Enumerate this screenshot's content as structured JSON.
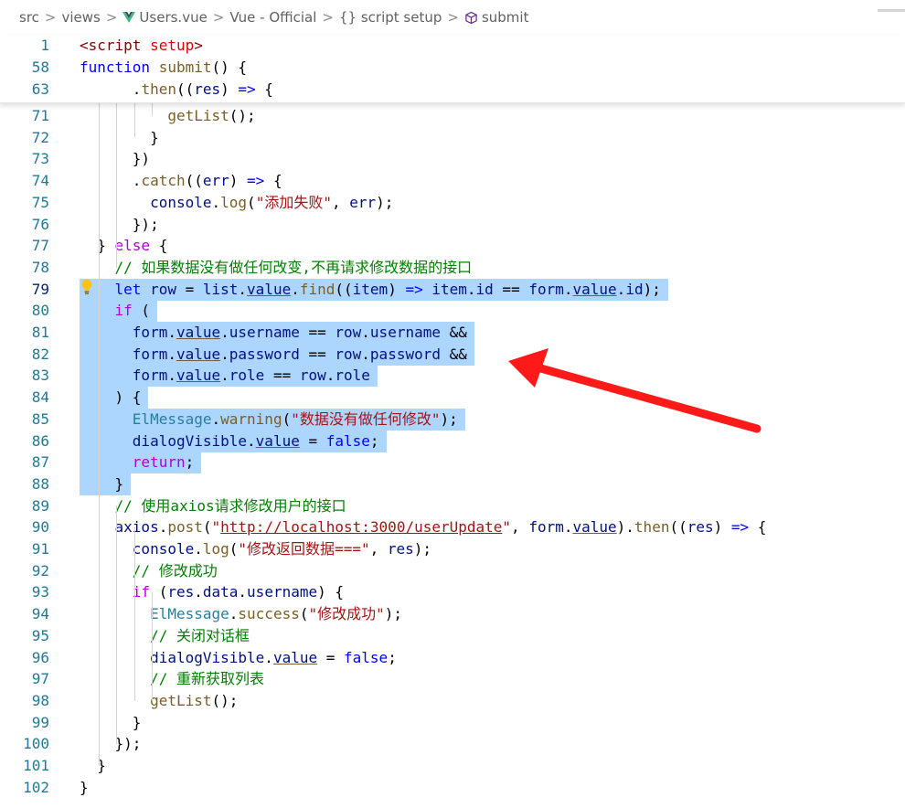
{
  "breadcrumb": {
    "items": [
      "src",
      "views",
      "Users.vue",
      "Vue - Official",
      "{} script setup",
      "submit"
    ],
    "separator": ">"
  },
  "sticky_lines": [
    {
      "num": "1",
      "tokens": [
        [
          "tag",
          "<script "
        ],
        [
          "attr",
          "setup"
        ],
        [
          "tag",
          ">"
        ]
      ]
    },
    {
      "num": "58",
      "tokens": [
        [
          "kw",
          "function "
        ],
        [
          "fn",
          "submit"
        ],
        [
          "",
          "() {"
        ]
      ]
    },
    {
      "num": "63",
      "tokens": [
        [
          "",
          "      ."
        ],
        [
          "fn",
          "then"
        ],
        [
          "",
          "(("
        ],
        [
          "var",
          "res"
        ],
        [
          "",
          ") "
        ],
        [
          "kw",
          "=>"
        ],
        [
          "",
          " {"
        ]
      ]
    }
  ],
  "lines": [
    {
      "num": "71",
      "tokens": [
        [
          "",
          "          "
        ],
        [
          "fn",
          "getList"
        ],
        [
          "",
          "();"
        ]
      ]
    },
    {
      "num": "72",
      "tokens": [
        [
          "",
          "        }"
        ]
      ]
    },
    {
      "num": "73",
      "tokens": [
        [
          "",
          "      })"
        ]
      ]
    },
    {
      "num": "74",
      "tokens": [
        [
          "",
          "      ."
        ],
        [
          "fn",
          "catch"
        ],
        [
          "",
          "(("
        ],
        [
          "var",
          "err"
        ],
        [
          "",
          ") "
        ],
        [
          "kw",
          "=>"
        ],
        [
          "",
          " {"
        ]
      ]
    },
    {
      "num": "75",
      "tokens": [
        [
          "",
          "        "
        ],
        [
          "var",
          "console"
        ],
        [
          "",
          "."
        ],
        [
          "fn",
          "log"
        ],
        [
          "",
          "("
        ],
        [
          "str",
          "\"添加失败\""
        ],
        [
          "",
          ", "
        ],
        [
          "var",
          "err"
        ],
        [
          "",
          ");"
        ]
      ]
    },
    {
      "num": "76",
      "tokens": [
        [
          "",
          "      });"
        ]
      ]
    },
    {
      "num": "77",
      "tokens": [
        [
          "",
          "  } "
        ],
        [
          "ctl",
          "else"
        ],
        [
          "",
          " {"
        ]
      ]
    },
    {
      "num": "78",
      "tokens": [
        [
          "",
          "    "
        ],
        [
          "cm",
          "// 如果数据没有做任何改变,不再请求修改数据的接口"
        ]
      ]
    },
    {
      "num": "79",
      "active": true,
      "tokens": [
        [
          "",
          "    "
        ],
        [
          "kw",
          "let "
        ],
        [
          "var",
          "row"
        ],
        [
          "",
          " = "
        ],
        [
          "var",
          "list"
        ],
        [
          "",
          "."
        ],
        [
          "var u",
          "value"
        ],
        [
          "",
          "."
        ],
        [
          "fn",
          "find"
        ],
        [
          "",
          "(("
        ],
        [
          "var",
          "item"
        ],
        [
          "",
          ") "
        ],
        [
          "kw",
          "=>"
        ],
        [
          "",
          " "
        ],
        [
          "var",
          "item"
        ],
        [
          "",
          "."
        ],
        [
          "var",
          "id"
        ],
        [
          "",
          " == "
        ],
        [
          "var",
          "form"
        ],
        [
          "",
          "."
        ],
        [
          "var u",
          "value"
        ],
        [
          "",
          "."
        ],
        [
          "var",
          "id"
        ],
        [
          "",
          ");"
        ]
      ]
    },
    {
      "num": "80",
      "tokens": [
        [
          "",
          "    "
        ],
        [
          "ctl",
          "if"
        ],
        [
          "",
          " ("
        ]
      ]
    },
    {
      "num": "81",
      "tokens": [
        [
          "",
          "      "
        ],
        [
          "var",
          "form"
        ],
        [
          "",
          "."
        ],
        [
          "var u",
          "value"
        ],
        [
          "",
          "."
        ],
        [
          "var",
          "username"
        ],
        [
          "",
          " == "
        ],
        [
          "var",
          "row"
        ],
        [
          "",
          "."
        ],
        [
          "var",
          "username"
        ],
        [
          "",
          " &&"
        ]
      ]
    },
    {
      "num": "82",
      "tokens": [
        [
          "",
          "      "
        ],
        [
          "var",
          "form"
        ],
        [
          "",
          "."
        ],
        [
          "var u",
          "value"
        ],
        [
          "",
          "."
        ],
        [
          "var",
          "password"
        ],
        [
          "",
          " == "
        ],
        [
          "var",
          "row"
        ],
        [
          "",
          "."
        ],
        [
          "var",
          "password"
        ],
        [
          "",
          " &&"
        ]
      ]
    },
    {
      "num": "83",
      "tokens": [
        [
          "",
          "      "
        ],
        [
          "var",
          "form"
        ],
        [
          "",
          "."
        ],
        [
          "var u",
          "value"
        ],
        [
          "",
          "."
        ],
        [
          "var",
          "role"
        ],
        [
          "",
          " == "
        ],
        [
          "var",
          "row"
        ],
        [
          "",
          "."
        ],
        [
          "var",
          "role"
        ]
      ]
    },
    {
      "num": "84",
      "tokens": [
        [
          "",
          "    ) {"
        ]
      ]
    },
    {
      "num": "85",
      "tokens": [
        [
          "",
          "      "
        ],
        [
          "cls",
          "ElMessage"
        ],
        [
          "",
          "."
        ],
        [
          "fn",
          "warning"
        ],
        [
          "",
          "("
        ],
        [
          "str",
          "\"数据没有做任何修改\""
        ],
        [
          "",
          ");"
        ]
      ]
    },
    {
      "num": "86",
      "tokens": [
        [
          "",
          "      "
        ],
        [
          "var",
          "dialogVisible"
        ],
        [
          "",
          "."
        ],
        [
          "var u",
          "value"
        ],
        [
          "",
          " = "
        ],
        [
          "kw",
          "false"
        ],
        [
          "",
          ";"
        ]
      ]
    },
    {
      "num": "87",
      "tokens": [
        [
          "",
          "      "
        ],
        [
          "ctl",
          "return"
        ],
        [
          "",
          ";"
        ]
      ]
    },
    {
      "num": "88",
      "tokens": [
        [
          "",
          "    }"
        ]
      ]
    },
    {
      "num": "89",
      "tokens": [
        [
          "",
          "    "
        ],
        [
          "cm",
          "// 使用axios请求修改用户的接口"
        ]
      ]
    },
    {
      "num": "90",
      "tokens": [
        [
          "",
          "    "
        ],
        [
          "var",
          "axios"
        ],
        [
          "",
          "."
        ],
        [
          "fn",
          "post"
        ],
        [
          "",
          "("
        ],
        [
          "str",
          "\""
        ],
        [
          "str link",
          "http://localhost:3000/userUpdate"
        ],
        [
          "str",
          "\""
        ],
        [
          "",
          ", "
        ],
        [
          "var",
          "form"
        ],
        [
          "",
          "."
        ],
        [
          "var u",
          "value"
        ],
        [
          "",
          ")."
        ],
        [
          "fn",
          "then"
        ],
        [
          "",
          "(("
        ],
        [
          "var",
          "res"
        ],
        [
          "",
          ") "
        ],
        [
          "kw",
          "=>"
        ],
        [
          "",
          " {"
        ]
      ]
    },
    {
      "num": "91",
      "tokens": [
        [
          "",
          "      "
        ],
        [
          "var",
          "console"
        ],
        [
          "",
          "."
        ],
        [
          "fn",
          "log"
        ],
        [
          "",
          "("
        ],
        [
          "str",
          "\"修改返回数据===\""
        ],
        [
          "",
          ", "
        ],
        [
          "var",
          "res"
        ],
        [
          "",
          ");"
        ]
      ]
    },
    {
      "num": "92",
      "tokens": [
        [
          "",
          "      "
        ],
        [
          "cm",
          "// 修改成功"
        ]
      ]
    },
    {
      "num": "93",
      "tokens": [
        [
          "",
          "      "
        ],
        [
          "ctl",
          "if"
        ],
        [
          "",
          " ("
        ],
        [
          "var",
          "res"
        ],
        [
          "",
          "."
        ],
        [
          "var",
          "data"
        ],
        [
          "",
          "."
        ],
        [
          "var",
          "username"
        ],
        [
          "",
          ") {"
        ]
      ]
    },
    {
      "num": "94",
      "tokens": [
        [
          "",
          "        "
        ],
        [
          "cls",
          "ElMessage"
        ],
        [
          "",
          "."
        ],
        [
          "fn",
          "success"
        ],
        [
          "",
          "("
        ],
        [
          "str",
          "\"修改成功\""
        ],
        [
          "",
          ");"
        ]
      ]
    },
    {
      "num": "95",
      "tokens": [
        [
          "",
          "        "
        ],
        [
          "cm",
          "// 关闭对话框"
        ]
      ]
    },
    {
      "num": "96",
      "tokens": [
        [
          "",
          "        "
        ],
        [
          "var",
          "dialogVisible"
        ],
        [
          "",
          "."
        ],
        [
          "var u",
          "value"
        ],
        [
          "",
          " = "
        ],
        [
          "kw",
          "false"
        ],
        [
          "",
          ";"
        ]
      ]
    },
    {
      "num": "97",
      "tokens": [
        [
          "",
          "        "
        ],
        [
          "cm",
          "// 重新获取列表"
        ]
      ]
    },
    {
      "num": "98",
      "tokens": [
        [
          "",
          "        "
        ],
        [
          "fn",
          "getList"
        ],
        [
          "",
          "();"
        ]
      ]
    },
    {
      "num": "99",
      "tokens": [
        [
          "",
          "      }"
        ]
      ]
    },
    {
      "num": "100",
      "tokens": [
        [
          "",
          "    });"
        ]
      ]
    },
    {
      "num": "101",
      "tokens": [
        [
          "",
          "  }"
        ]
      ]
    },
    {
      "num": "102",
      "tokens": [
        [
          "",
          "}"
        ]
      ]
    }
  ],
  "selection": {
    "from_line": "79",
    "to_line": "88"
  },
  "colors": {
    "selection": "#add6ff",
    "annotation_arrow": "#ff1a1a",
    "line_number": "#237893"
  },
  "icons": [
    "vue-logo-icon",
    "braces-icon",
    "cube-icon",
    "lightbulb-icon",
    "red-arrow-annotation"
  ]
}
